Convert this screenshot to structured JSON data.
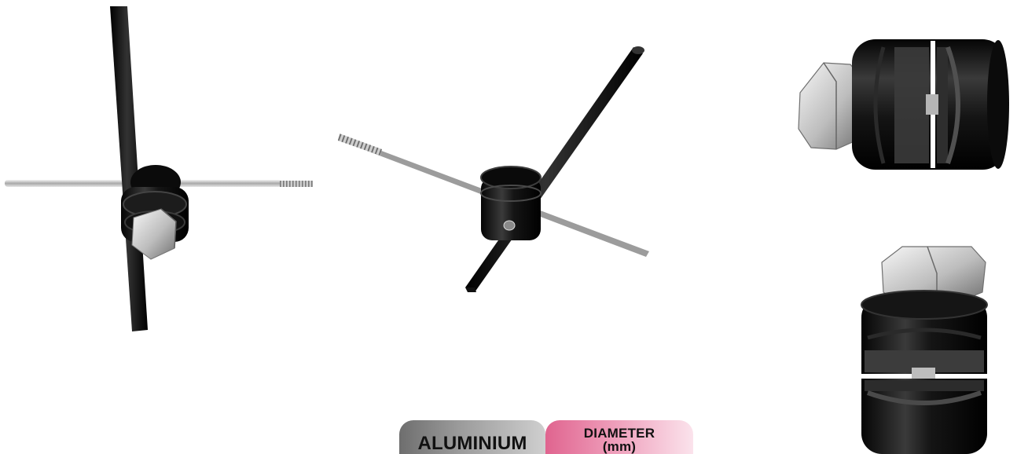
{
  "scene": {
    "background_color": "#ffffff",
    "views": [
      {
        "name": "front-assembly-view",
        "icon": "rod-clamp-assembly"
      },
      {
        "name": "perspective-assembly-view",
        "icon": "rod-clamp-assembly"
      },
      {
        "name": "clamp-side-view",
        "icon": "clamp-cylinder"
      },
      {
        "name": "clamp-top-view",
        "icon": "clamp-cylinder"
      }
    ],
    "colors": {
      "rod": "#111111",
      "pin": "#c8c8c8",
      "nut": "#d9d9d9"
    }
  },
  "tabs": {
    "material_label": "ALUMINIUM",
    "diameter_label": "DIAMETER",
    "diameter_unit": "(mm)",
    "material_color": "#8a8a8a",
    "diameter_color": "#e86f98"
  }
}
